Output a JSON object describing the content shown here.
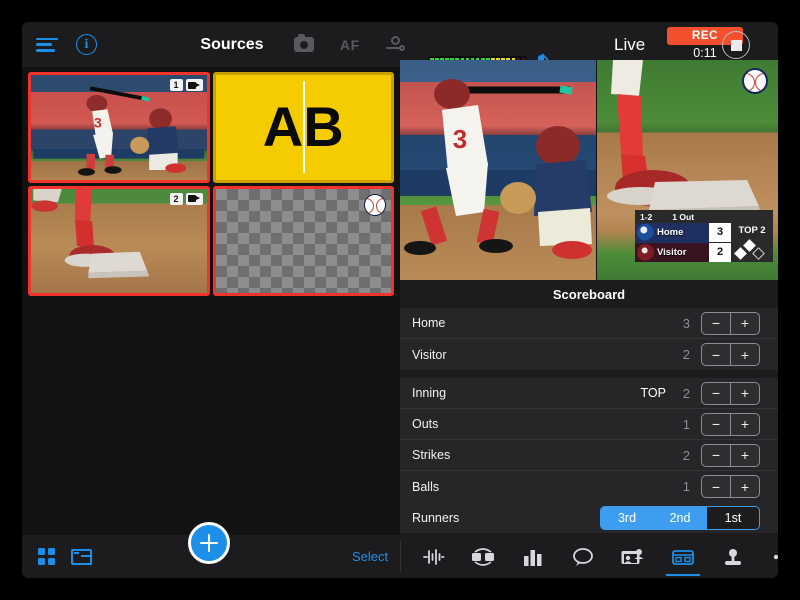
{
  "header": {
    "menu_icon": "hamburger-icon",
    "info_icon": "info-icon",
    "title": "Sources",
    "camera_icon": "camera-icon",
    "af_label": "AF",
    "focus_icon": "focus-person-icon",
    "mic_icon": "microphone-muted-icon",
    "live_label": "Live",
    "rec_label": "REC",
    "rec_time": "0:11",
    "stop_icon": "stop-square-icon",
    "audio_meter": {
      "green_segments": 12,
      "yellow_segments": 5,
      "red_segments": 2,
      "green_color": "#2fd62f",
      "yellow_color": "#e8dc20",
      "red_color": "#4a1212"
    }
  },
  "sources": [
    {
      "badge_number": "1",
      "badge_icon": "video-camera-icon",
      "kind": "camera-batter",
      "border": "#f1322d",
      "name": "source-1"
    },
    {
      "label_a": "A",
      "label_b": "B",
      "kind": "ab-graphic",
      "border": "#c8a000",
      "name": "source-ab-graphic"
    },
    {
      "badge_number": "2",
      "badge_icon": "video-camera-icon",
      "kind": "camera-base",
      "border": "#f1322d",
      "name": "source-2"
    },
    {
      "badge_icon": "baseball-icon",
      "kind": "scoreboard-overlay",
      "border": "#f1322d",
      "name": "source-scoreboard"
    }
  ],
  "preview": {
    "name": "preview-monitor"
  },
  "program": {
    "name": "program-monitor",
    "ball_badge_icon": "baseball-icon",
    "overlay": {
      "count": "1-2",
      "outs": "1 Out",
      "home_name": "Home",
      "home_score": "3",
      "visitor_name": "Visitor",
      "visitor_score": "2",
      "inning": "TOP 2",
      "runner_second": true,
      "runner_third": true,
      "runner_first": false
    }
  },
  "scoreboard_panel": {
    "title": "Scoreboard",
    "minus_label": "−",
    "plus_label": "+",
    "group_one": [
      {
        "label": "Home",
        "value": "3",
        "sub": ""
      },
      {
        "label": "Visitor",
        "value": "2",
        "sub": ""
      }
    ],
    "group_two": [
      {
        "label": "Inning",
        "value": "2",
        "sub": "TOP"
      },
      {
        "label": "Outs",
        "value": "1",
        "sub": ""
      },
      {
        "label": "Strikes",
        "value": "2",
        "sub": ""
      },
      {
        "label": "Balls",
        "value": "1",
        "sub": ""
      }
    ],
    "runners": {
      "label": "Runners",
      "options": [
        {
          "label": "3rd",
          "active": true
        },
        {
          "label": "2nd",
          "active": true
        },
        {
          "label": "1st",
          "active": false
        }
      ],
      "active_color": "#3d9ef0"
    }
  },
  "bottom_bar": {
    "grid_icon": "grid-layout-icon",
    "pip_icon": "picture-in-picture-icon",
    "add_icon": "add-plus-icon",
    "select_label": "Select",
    "tools": [
      {
        "icon": "audio-waveform-icon",
        "active": false,
        "name": "tool-audio"
      },
      {
        "icon": "transition-icon",
        "active": false,
        "name": "tool-transition"
      },
      {
        "icon": "bar-chart-icon",
        "active": false,
        "name": "tool-graphics"
      },
      {
        "icon": "comment-bubble-icon",
        "active": false,
        "name": "tool-comments"
      },
      {
        "icon": "guest-screen-icon",
        "active": false,
        "name": "tool-guests"
      },
      {
        "icon": "scoreboard-icon",
        "active": true,
        "name": "tool-scoreboard"
      },
      {
        "icon": "joystick-icon",
        "active": false,
        "name": "tool-ptz"
      },
      {
        "icon": "more-dots-icon",
        "active": false,
        "name": "tool-more"
      }
    ]
  }
}
